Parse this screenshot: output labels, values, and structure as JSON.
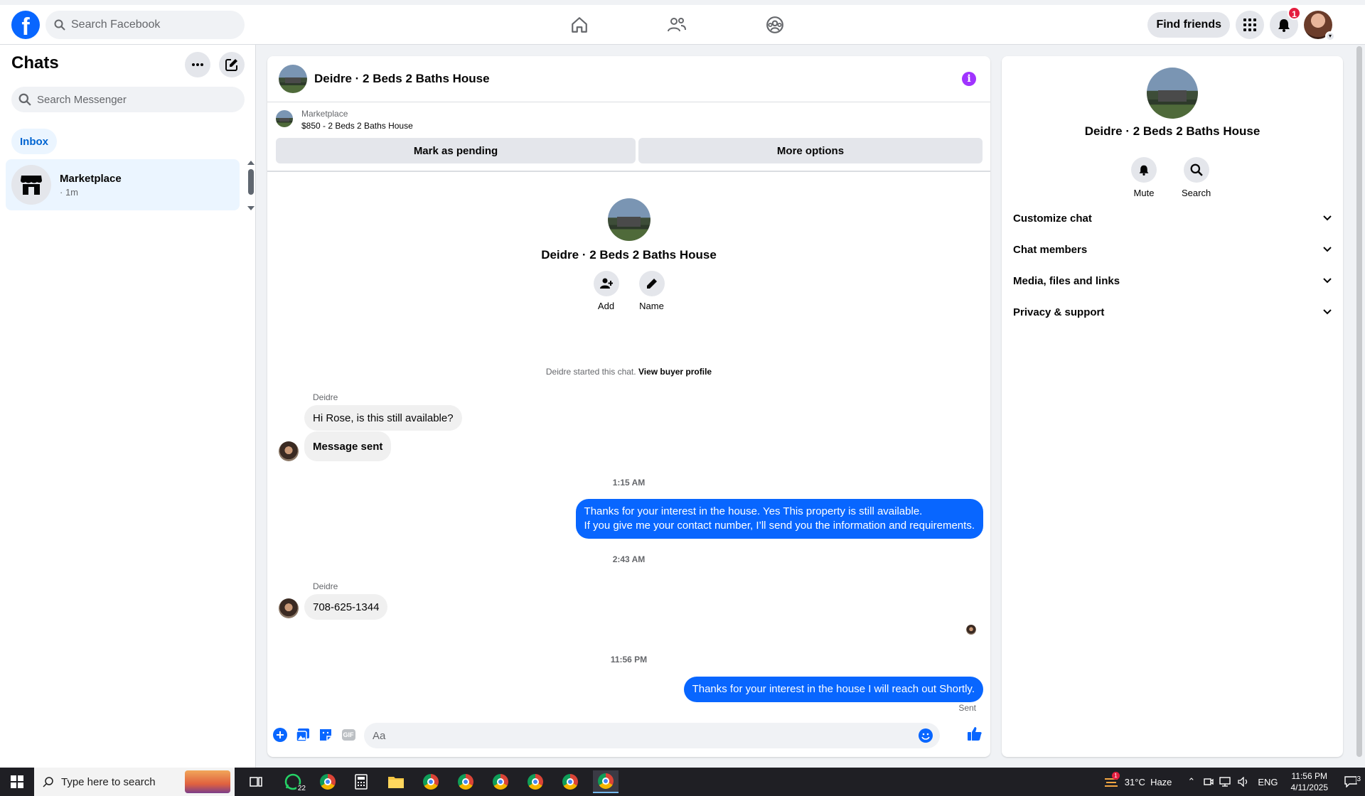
{
  "topbar": {
    "logo_letter": "f",
    "search_placeholder": "Search Facebook",
    "find_friends": "Find friends",
    "notification_count": "1"
  },
  "left": {
    "title": "Chats",
    "search_placeholder": "Search Messenger",
    "inbox_label": "Inbox",
    "chats": [
      {
        "name": "Marketplace",
        "time": "· 1m"
      }
    ]
  },
  "conversation": {
    "title": "Deidre · 2 Beds 2 Baths House",
    "marketplace_label": "Marketplace",
    "listing": "$850 - 2 Beds 2 Baths House",
    "mark_pending": "Mark as pending",
    "more_options": "More options",
    "intro_add": "Add",
    "intro_name": "Name",
    "started_text": "Deidre started this chat.",
    "view_buyer": "View buyer profile",
    "messages": {
      "sender1": "Deidre",
      "in1": "Hi Rose, is this still available?",
      "in2": "Message sent",
      "time1": "1:15 AM",
      "out1_line1": "Thanks for your interest in the house. Yes This property is still available.",
      "out1_line2": "If you give me your contact number, I’ll send you the information and requirements.",
      "time2": "2:43 AM",
      "sender2": "Deidre",
      "in3": "708-625-1344",
      "time3": "11:56 PM",
      "out2": "Thanks for your interest in the house I will reach out Shortly.",
      "status": "Sent"
    },
    "composer_placeholder": "Aa",
    "gif_label": "GIF"
  },
  "details": {
    "title": "Deidre · 2 Beds 2 Baths House",
    "mute": "Mute",
    "search": "Search",
    "sections": [
      "Customize chat",
      "Chat members",
      "Media, files and links",
      "Privacy & support"
    ]
  },
  "taskbar": {
    "search_placeholder": "Type here to search",
    "whatsapp_badge": "22",
    "weather": "31°C  Haze",
    "weather_badge": "1",
    "lang": "ENG",
    "time": "11:56 PM",
    "date": "4/11/2025",
    "notif_count": "3"
  },
  "colors": {
    "brand_blue": "#0866ff",
    "badge_red": "#e41e3f",
    "info_purple": "#a033ff"
  }
}
